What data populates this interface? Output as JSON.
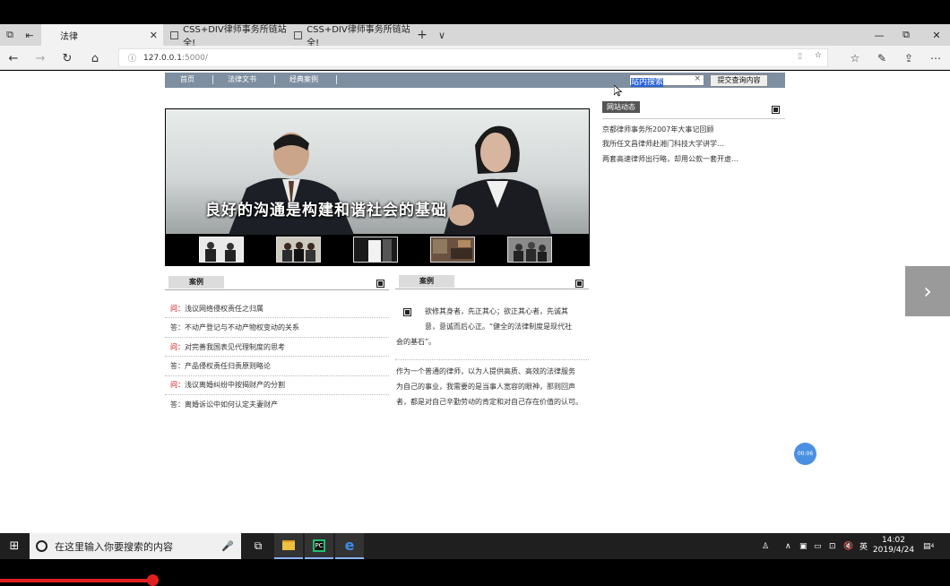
{
  "browser": {
    "tabs": [
      {
        "title": "法律",
        "active": true
      },
      {
        "title": "CSS+DIV律师事务所链站全!",
        "active": false
      },
      {
        "title": "CSS+DIV律师事务所链站全!",
        "active": false
      }
    ],
    "new_tab_label": "+",
    "tab_list_label": "∨",
    "url": "127.0.0.1",
    "url_port": ":5000/"
  },
  "site": {
    "nav": [
      "首页",
      "法律文书",
      "经典案例"
    ],
    "search": {
      "value": "站内搜索",
      "clear": "×",
      "button": "提交查询内容"
    },
    "banner_caption": "良好的沟通是构建和谐社会的基础",
    "news": {
      "title": "网站动态",
      "items": [
        "京都律师事务所2007年大事记回顾",
        "我所任文昌律师赴湘门科技大学讲学…",
        "两套高速律师出行略，却用公款一套开虚…"
      ]
    },
    "cases": {
      "header": "案例",
      "items": [
        {
          "prefix": "问：",
          "text": "浅议网络侵权责任之归属",
          "q": true
        },
        {
          "prefix": "答：",
          "text": "不动产登记与不动产物权变动的关系",
          "q": false
        },
        {
          "prefix": "问：",
          "text": "对完善我国表见代理制度的思考",
          "q": true
        },
        {
          "prefix": "答：",
          "text": "产品侵权责任归责原则略论",
          "q": false
        },
        {
          "prefix": "问：",
          "text": "浅议离婚纠纷中按揭财产的分割",
          "q": true
        },
        {
          "prefix": "答：",
          "text": "离婚诉讼中如何认定夫妻财产",
          "q": false
        }
      ]
    },
    "cases2": {
      "header": "案例",
      "para1_lines": [
        "欲修其身者，先正其心；欲正其心者，先诚其",
        "意，意诚而后心正。“健全的法律制度是现代社",
        "会的基石”。"
      ],
      "para2_lines": [
        "作为一个普通的律师，以为人提供高质、高效的法律服务",
        "为自己的事业，我需要的是当事人宽容的眼神，那则回声",
        "者，都是对自己辛勤劳动的肯定和对自己存在价值的认可。"
      ]
    }
  },
  "recorder": {
    "time": "00:06"
  },
  "taskbar": {
    "search_placeholder": "在这里输入你要搜索的内容",
    "time": "14:02",
    "date": "2019/4/24",
    "ime": "英",
    "notification_count": "4"
  },
  "colors": {
    "nav_bar": "#7e8fa1",
    "taskbar": "#1f1f1f",
    "accent_blue": "#2a64d6",
    "question_red": "#c00000"
  }
}
